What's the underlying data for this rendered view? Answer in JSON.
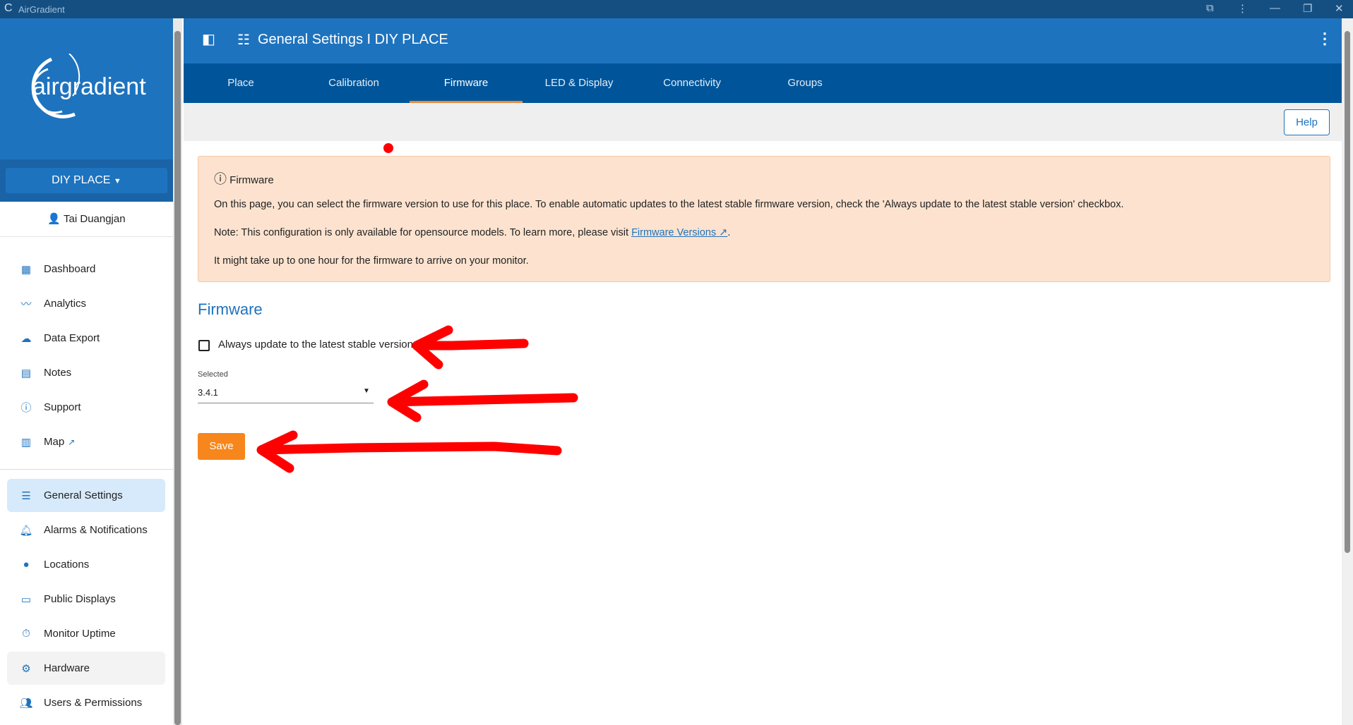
{
  "window": {
    "title": "AirGradient"
  },
  "sidebar": {
    "logo_text": "airgradient",
    "place_button": "DIY PLACE",
    "user_name": "Tai Duangjan",
    "items": [
      {
        "label": "Dashboard",
        "icon": "dashboard-icon"
      },
      {
        "label": "Analytics",
        "icon": "analytics-icon"
      },
      {
        "label": "Data Export",
        "icon": "cloud-download-icon"
      },
      {
        "label": "Notes",
        "icon": "notes-icon"
      },
      {
        "label": "Support",
        "icon": "info-icon"
      },
      {
        "label": "Map",
        "icon": "map-icon"
      },
      {
        "label": "General Settings",
        "icon": "sliders-icon"
      },
      {
        "label": "Alarms & Notifications",
        "icon": "bell-icon"
      },
      {
        "label": "Locations",
        "icon": "location-pin-icon"
      },
      {
        "label": "Public Displays",
        "icon": "displays-icon"
      },
      {
        "label": "Monitor Uptime",
        "icon": "stopwatch-icon"
      },
      {
        "label": "Hardware",
        "icon": "hardware-icon"
      },
      {
        "label": "Users & Permissions",
        "icon": "users-icon"
      }
    ]
  },
  "header": {
    "title": "General Settings I DIY PLACE"
  },
  "tabs": [
    "Place",
    "Calibration",
    "Firmware",
    "LED & Display",
    "Connectivity",
    "Groups"
  ],
  "active_tab": "Firmware",
  "toolbar": {
    "help": "Help"
  },
  "alert": {
    "title": "Firmware",
    "line1": "On this page, you can select the firmware version to use for this place. To enable automatic updates to the latest stable firmware version, check the 'Always update to the latest stable version' checkbox.",
    "line2_prefix": "Note: This configuration is only available for opensource models. To learn more, please visit ",
    "line2_link": "Firmware Versions",
    "line2_suffix": ".",
    "line3": "It might take up to one hour for the firmware to arrive on your monitor."
  },
  "form": {
    "heading": "Firmware",
    "checkbox_label": "Always update to the latest stable version",
    "checkbox_checked": false,
    "select_label": "Selected",
    "select_value": "3.4.1",
    "save": "Save"
  },
  "colors": {
    "brand": "#1e73be",
    "tabs": "#00559a",
    "accent": "#f7861c",
    "alert_bg": "#fde3cf",
    "annotation": "#ff0000"
  }
}
